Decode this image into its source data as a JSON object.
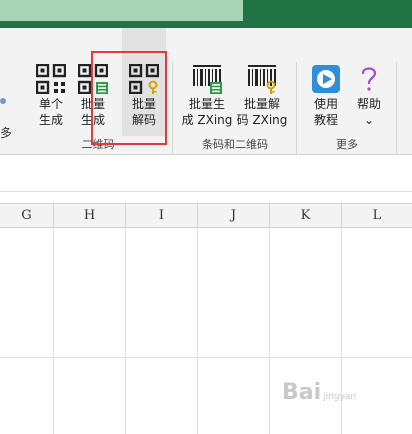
{
  "ribbon": {
    "left_cut_label": "多",
    "tools": [
      {
        "id": "single-gen",
        "label": "单个\n生成",
        "icon": "qr-code-icon"
      },
      {
        "id": "batch-gen",
        "label": "批量\n生成",
        "icon": "qr-code-batch-icon"
      },
      {
        "id": "batch-decode",
        "label": "批量\n解码",
        "icon": "qr-code-key-icon"
      },
      {
        "id": "batch-gen-zxing",
        "label": "批量生\n成 ZXing",
        "icon": "barcode-icon"
      },
      {
        "id": "batch-decode-zxing",
        "label": "批量解\n码 ZXing",
        "icon": "barcode-key-icon"
      },
      {
        "id": "tutorial",
        "label": "使用\n教程",
        "icon": "play-icon"
      },
      {
        "id": "help",
        "label": "帮助\n⌄",
        "icon": "question-icon"
      }
    ],
    "groups": {
      "qrcode": "二维码",
      "barcode": "条码和二维码",
      "more": "更多"
    }
  },
  "sheet": {
    "columns": [
      "G",
      "H",
      "I",
      "J",
      "K",
      "L"
    ]
  },
  "watermark": {
    "text": "Bai",
    "sub": "jingyan"
  },
  "colors": {
    "title_bar": "#217346",
    "highlight_box": "#e23b3b",
    "ribbon_bg": "#f3f3f3"
  }
}
